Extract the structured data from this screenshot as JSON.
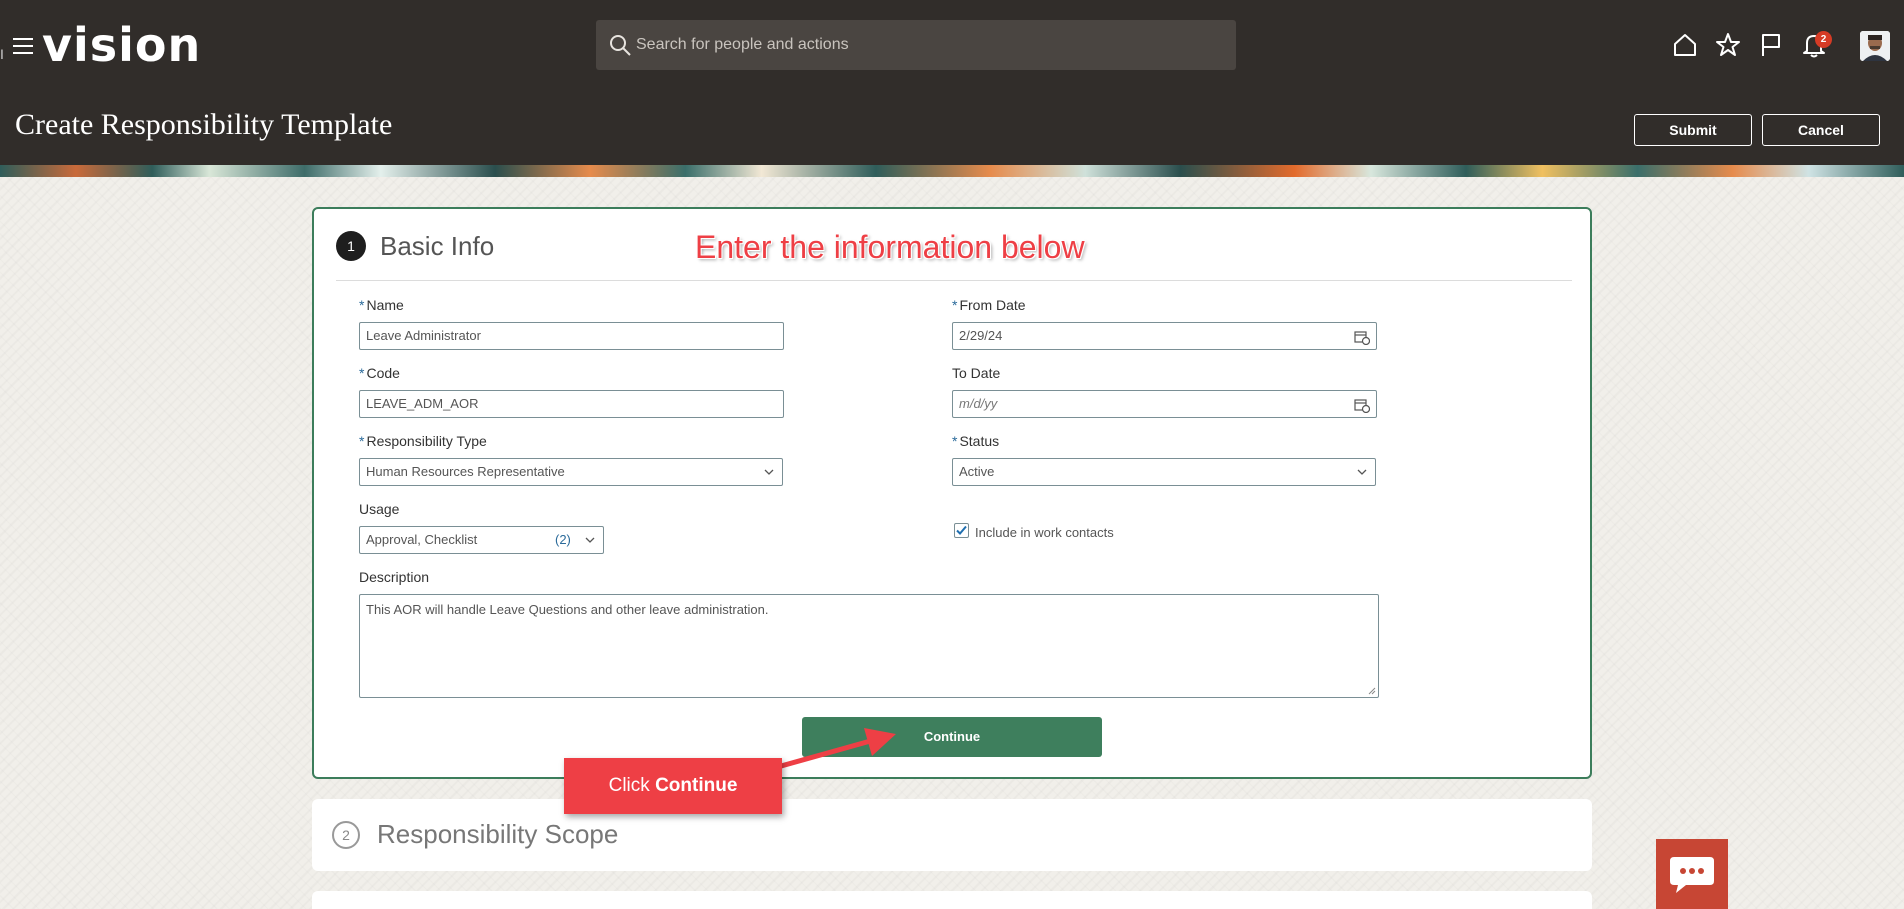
{
  "app": {
    "logo": "vision",
    "search_placeholder": "Search for people and actions",
    "notification_count": "2",
    "page_title": "Create Responsibility Template",
    "submit_label": "Submit",
    "cancel_label": "Cancel"
  },
  "step1": {
    "number": "1",
    "title": "Basic Info",
    "annotation": "Enter the information below"
  },
  "form": {
    "name": {
      "label": "Name",
      "required": "*",
      "value": "Leave Administrator"
    },
    "code": {
      "label": "Code",
      "required": "*",
      "value": "LEAVE_ADM_AOR"
    },
    "responsibility_type": {
      "label": "Responsibility Type",
      "required": "*",
      "value": "Human Resources Representative"
    },
    "usage": {
      "label": "Usage",
      "value": "Approval, Checklist",
      "count": "(2)"
    },
    "from_date": {
      "label": "From Date",
      "required": "*",
      "value": "2/29/24"
    },
    "to_date": {
      "label": "To Date",
      "placeholder": "m/d/yy"
    },
    "status": {
      "label": "Status",
      "required": "*",
      "value": "Active"
    },
    "include_contacts": {
      "label": "Include in work contacts",
      "checked": true
    },
    "description": {
      "label": "Description",
      "value": "This AOR will handle Leave Questions and other leave administration."
    },
    "continue_label": "Continue"
  },
  "callout": {
    "prefix": "Click ",
    "bold": "Continue"
  },
  "step2": {
    "number": "2",
    "title": "Responsibility Scope"
  },
  "colors": {
    "header_bg": "#312d2a",
    "accent_green": "#3e7f5d",
    "annotation_red": "#ee3f45",
    "badge_red": "#d63b25"
  },
  "icons": [
    "hamburger-icon",
    "search-icon",
    "home-icon",
    "star-icon",
    "flag-icon",
    "bell-icon",
    "calendar-icon",
    "chevron-down-icon",
    "checkmark-icon",
    "chat-icon"
  ]
}
